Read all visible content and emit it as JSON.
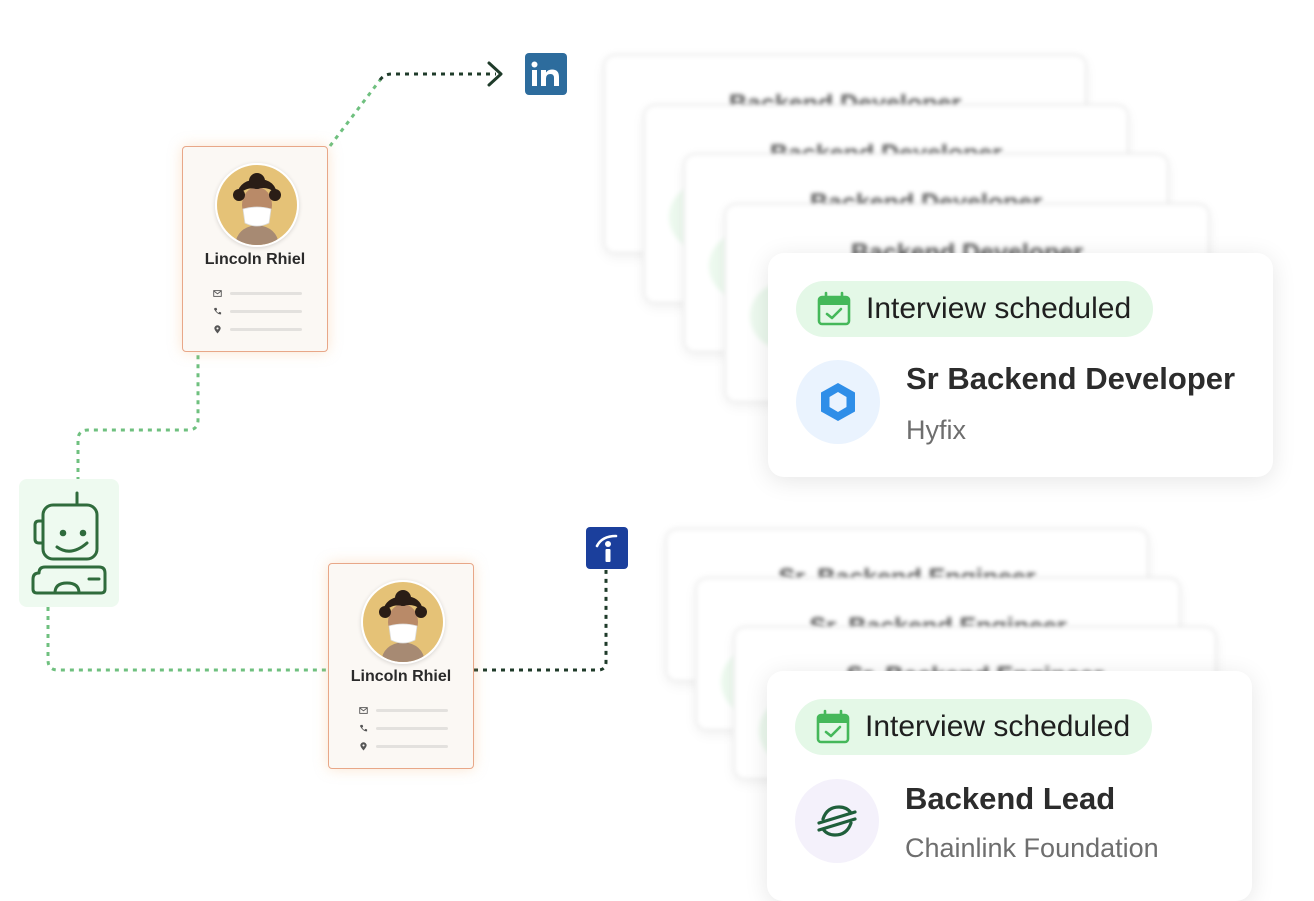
{
  "colors": {
    "accent_green": "#6fc07f",
    "dark_connector": "#1f3b2a",
    "linkedin": "#2d6c9d",
    "indeed": "#1b3f9c",
    "pill_bg": "#e4f8e7",
    "profile_border": "#e8a788"
  },
  "icons": {
    "robot": "robot-icon",
    "linkedin": "linkedin-icon",
    "indeed": "indeed-icon",
    "calendar": "calendar-check-icon",
    "hyfix": "hexagon-logo-icon",
    "chainlink": "stellar-logo-icon",
    "mail": "mail-icon",
    "phone": "phone-icon",
    "location": "location-pin-icon"
  },
  "profiles": [
    {
      "name": "Lincoln Rhiel"
    },
    {
      "name": "Lincoln Rhiel"
    }
  ],
  "ghost_titles_top": [
    "Backend Developer",
    "Backend Developer",
    "Backend Developer",
    "Backend Developer"
  ],
  "ghost_titles_bottom": [
    "Sr. Backend Engineer",
    "Sr. Backend Engineer",
    "Sr. Backend Engineer"
  ],
  "jobs": [
    {
      "status": "Interview scheduled",
      "title": "Sr Backend Developer",
      "company": "Hyfix"
    },
    {
      "status": "Interview scheduled",
      "title": "Backend Lead",
      "company": "Chainlink Foundation"
    }
  ]
}
